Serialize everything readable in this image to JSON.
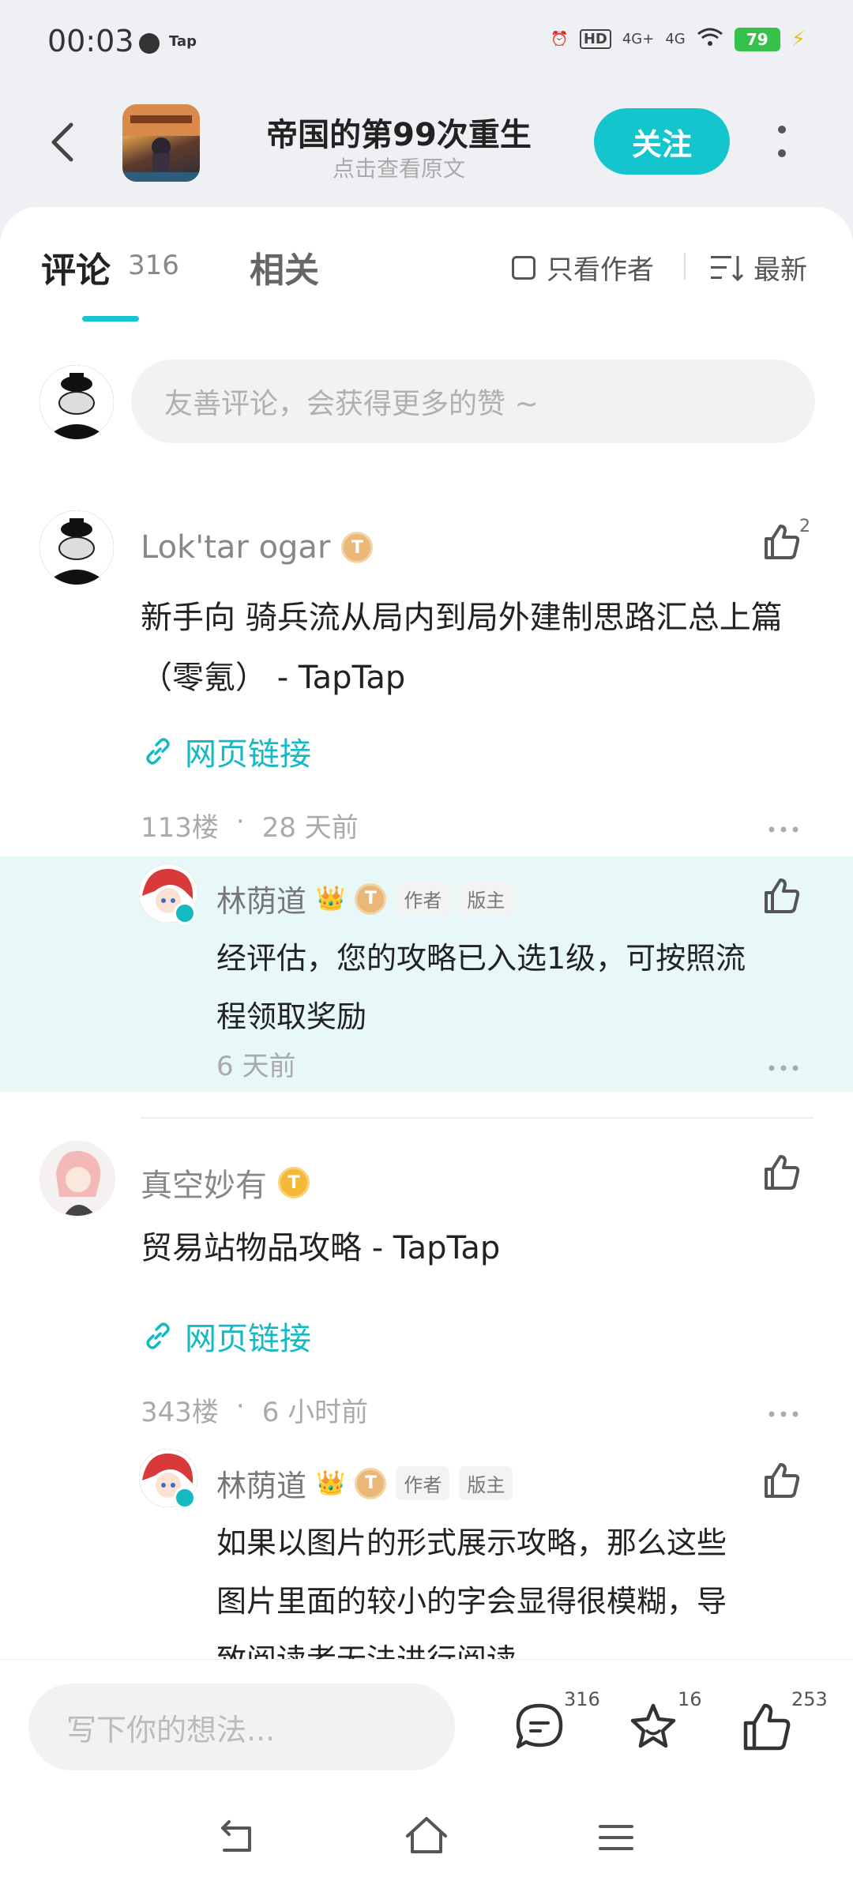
{
  "status_bar": {
    "time": "00:03",
    "tap": "Tap",
    "network1": "4G+",
    "network2": "4G",
    "battery": "79"
  },
  "header": {
    "title": "帝国的第99次重生",
    "subtitle": "点击查看原文",
    "follow_label": "关注"
  },
  "tabs": {
    "comments_label": "评论",
    "comments_count": "316",
    "related_label": "相关"
  },
  "filters": {
    "only_author_label": "只看作者",
    "sort_label": "最新"
  },
  "comment_input": {
    "placeholder": "友善评论，会获得更多的赞 ~"
  },
  "comments": [
    {
      "user": "Lok'tar ogar",
      "like_count": "2",
      "text_line1": "新手向 骑兵流从局内到局外建制思路汇总上篇",
      "text_line2": "（零氪） - TapTap",
      "link_label": "网页链接",
      "floor": "113楼",
      "time": "28 天前",
      "reply": {
        "user": "林荫道",
        "badge_author": "作者",
        "badge_mod": "版主",
        "text_line1": "经评估，您的攻略已入选1级，可按照流",
        "text_line2": "程领取奖励",
        "time": "6 天前"
      }
    },
    {
      "user": "真空妙有",
      "text_line1": "贸易站物品攻略 - TapTap",
      "link_label": "网页链接",
      "floor": "343楼",
      "time": "6 小时前",
      "reply": {
        "user": "林荫道",
        "badge_author": "作者",
        "badge_mod": "版主",
        "text_line1": "如果以图片的形式展示攻略，那么这些",
        "text_line2": "图片里面的较小的字会显得很模糊，导",
        "text_line3": "致阅读者无法进行阅读"
      }
    }
  ],
  "bottom_bar": {
    "placeholder": "写下你的想法...",
    "comment_count": "316",
    "favorite_count": "16",
    "like_count": "253"
  },
  "colors": {
    "accent": "#15c5ce",
    "reply_bg": "#e8f7f7",
    "link": "#15b9c2"
  }
}
